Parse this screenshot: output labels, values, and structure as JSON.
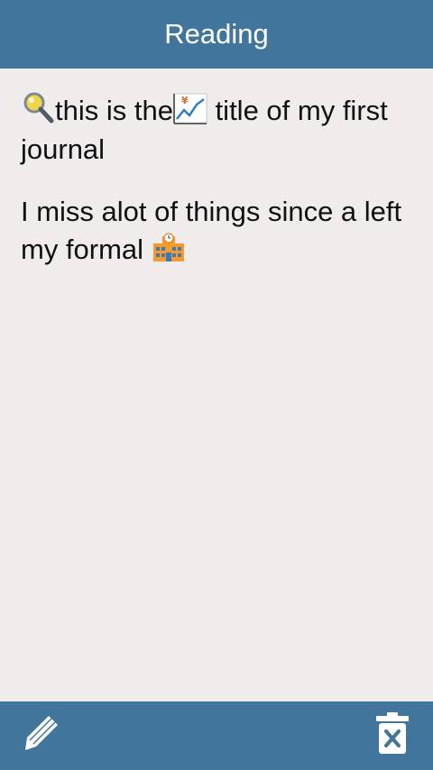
{
  "header": {
    "title": "Reading"
  },
  "journal": {
    "title_part1": "this is the",
    "title_part2": " title of my first journal",
    "body": "I miss  alot of things since a left my formal "
  },
  "icons": {
    "title_start": "magnifier-icon",
    "title_middle": "chart-yen-icon",
    "body_end": "school-building-icon",
    "edit": "pencil-icon",
    "delete": "trash-x-icon"
  },
  "colors": {
    "bar": "#41759b",
    "background": "#efeceb",
    "text": "#111111",
    "header_text": "#ffffff"
  }
}
